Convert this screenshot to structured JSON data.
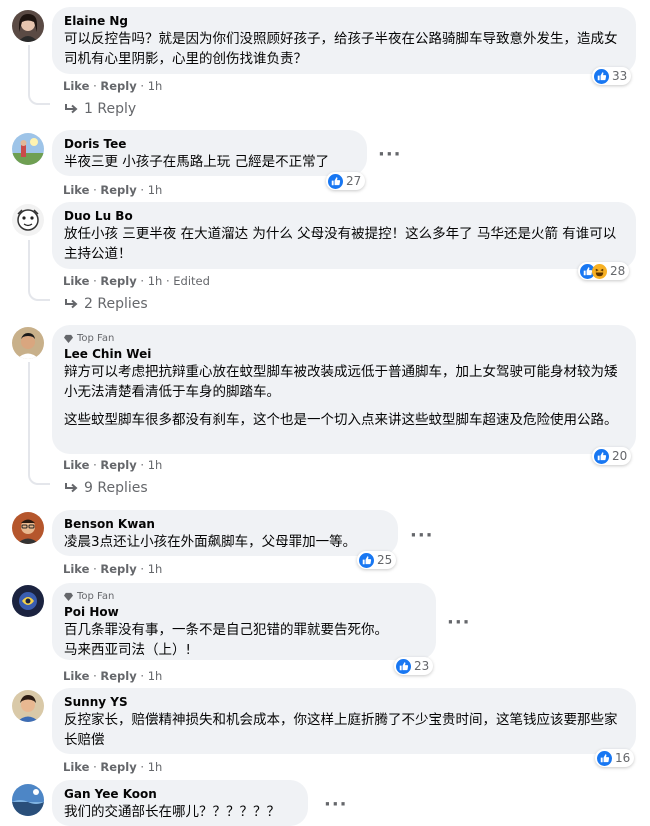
{
  "colors": {
    "like_blue": "#1877f2",
    "bubble_bg": "#f0f2f5",
    "meta_gray": "#65676b",
    "haha_yellow": "#f7b125"
  },
  "action_labels": {
    "like": "Like",
    "reply": "Reply",
    "sep": "·"
  },
  "comments": [
    {
      "name": "Elaine Ng",
      "text": [
        "可以反控告吗？就是因为你们没照顾好孩子，给孩子半夜在公路骑脚车导致意外发生，造成女司机有心里阴影，心里的创伤找谁负责？"
      ],
      "reactions": [
        "like-icon"
      ],
      "reaction_count": "33",
      "time": "1h",
      "edited": "",
      "replies": "1 Reply",
      "top_fan": false
    },
    {
      "name": "Doris Tee",
      "text": [
        "半夜三更 小孩子在馬路上玩 己經是不正常了"
      ],
      "reactions": [
        "like-icon"
      ],
      "reaction_count": "27",
      "time": "1h",
      "edited": "",
      "replies": "",
      "top_fan": false
    },
    {
      "name": "Duo Lu Bo",
      "text": [
        "放任小孩 三更半夜 在大道溜达 为什么 父母没有被提控！这么多年了 马华还是火箭 有谁可以主持公道！"
      ],
      "reactions": [
        "like-icon",
        "haha-icon"
      ],
      "reaction_count": "28",
      "time": "1h",
      "edited": "Edited",
      "replies": "2 Replies",
      "top_fan": false
    },
    {
      "name": "Lee Chin Wei",
      "text": [
        "辩方可以考虑把抗辩重心放在蚊型脚车被改装成远低于普通脚车，加上女驾驶可能身材较为矮小无法清楚看清低于车身的脚踏车。",
        "这些蚊型脚车很多都没有刹车，这个也是一个切入点来讲这些蚊型脚车超速及危险使用公路。"
      ],
      "reactions": [
        "like-icon"
      ],
      "reaction_count": "20",
      "time": "1h",
      "edited": "",
      "replies": "9 Replies",
      "top_fan": true,
      "top_fan_label": "Top Fan"
    },
    {
      "name": "Benson Kwan",
      "text": [
        "凌晨3点还让小孩在外面飙脚车，父母罪加一等。"
      ],
      "reactions": [
        "like-icon"
      ],
      "reaction_count": "25",
      "time": "1h",
      "edited": "",
      "replies": "",
      "top_fan": false
    },
    {
      "name": "Poi How",
      "text": [
        "百几条罪没有事，一条不是自己犯错的罪就要告死你。",
        "马来西亚司法（上）!"
      ],
      "reactions": [
        "like-icon"
      ],
      "reaction_count": "23",
      "time": "1h",
      "edited": "",
      "replies": "",
      "top_fan": true,
      "top_fan_label": "Top Fan"
    },
    {
      "name": "Sunny YS",
      "text": [
        "反控家长，赔偿精神损失和机会成本，你这样上庭折腾了不少宝贵时间，这笔钱应该要那些家长赔偿"
      ],
      "reactions": [
        "like-icon"
      ],
      "reaction_count": "16",
      "time": "1h",
      "edited": "",
      "replies": "",
      "top_fan": false
    },
    {
      "name": "Gan Yee Koon",
      "text": [
        "我们的交通部长在哪儿？？？？？？"
      ],
      "reactions": [],
      "reaction_count": "",
      "time": "",
      "edited": "",
      "replies": "",
      "top_fan": false
    }
  ]
}
